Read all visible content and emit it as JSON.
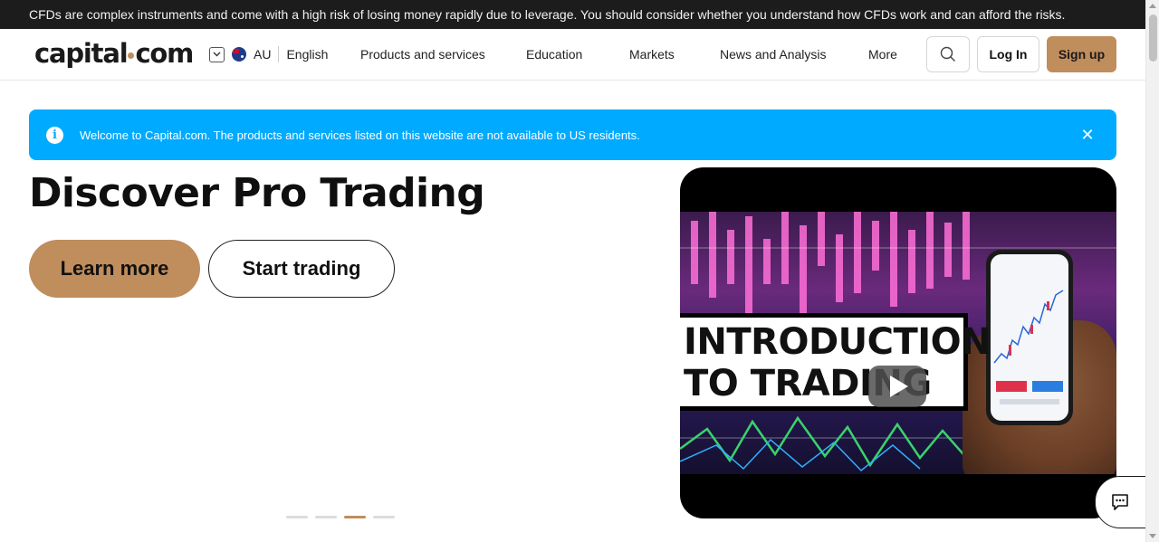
{
  "risk_warning": "CFDs are complex instruments and come with a high risk of losing money rapidly due to leverage. You should consider whether you understand how CFDs work and can afford the risks.",
  "header": {
    "logo_left": "capital",
    "logo_right": "com",
    "region_code": "AU",
    "language": "English",
    "nav": {
      "products": "Products and services",
      "education": "Education",
      "markets": "Markets",
      "news": "News and Analysis",
      "more": "More"
    },
    "login_label": "Log In",
    "signup_label": "Sign up"
  },
  "notice": {
    "message": "Welcome to Capital.com. The products and services listed on this website are not available to US residents."
  },
  "hero": {
    "title": "Discover Pro Trading",
    "learn_more": "Learn more",
    "start_trading": "Start trading",
    "active_slide": 3,
    "slide_count": 4
  },
  "video": {
    "title_line1": "INTRODUCTION",
    "title_line2": "TO TRADING"
  },
  "colors": {
    "accent": "#c08d5c",
    "notice_bg": "#00aaff",
    "risk_bar_bg": "#1c1c1c"
  },
  "icons": {
    "region_toggle": "chevron-down-icon",
    "flag": "australia-flag-icon",
    "info": "info-icon",
    "close": "close-icon",
    "search": "search-icon",
    "play": "play-icon",
    "chat": "chat-icon"
  }
}
